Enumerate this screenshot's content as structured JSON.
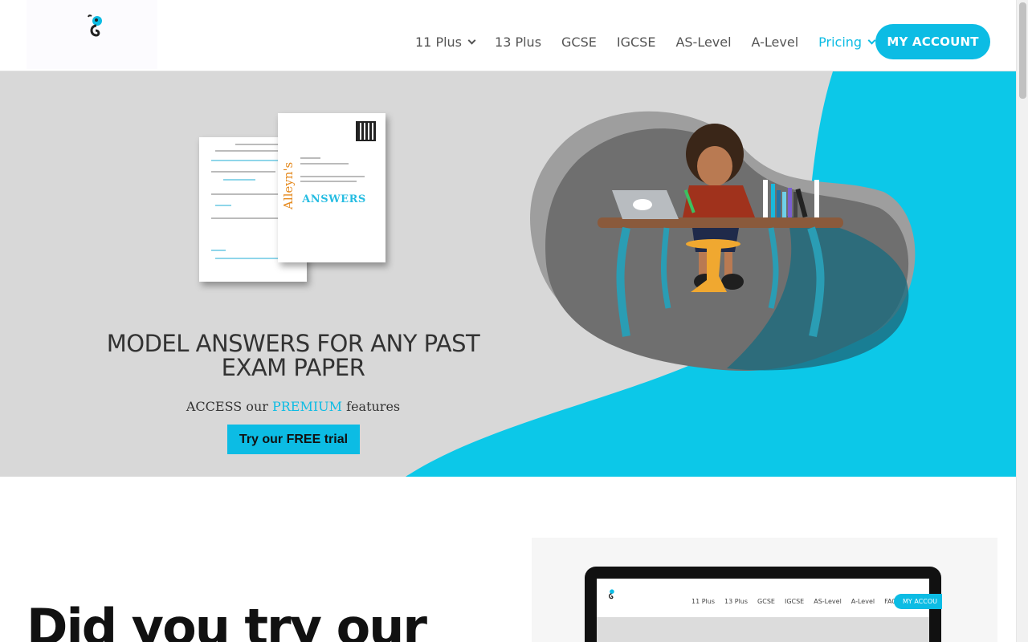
{
  "nav": {
    "items": [
      {
        "label": "11 Plus",
        "has_dropdown": true,
        "active": false
      },
      {
        "label": "13 Plus",
        "has_dropdown": false,
        "active": false
      },
      {
        "label": "GCSE",
        "has_dropdown": false,
        "active": false
      },
      {
        "label": "IGCSE",
        "has_dropdown": false,
        "active": false
      },
      {
        "label": "AS-Level",
        "has_dropdown": false,
        "active": false
      },
      {
        "label": "A-Level",
        "has_dropdown": false,
        "active": false
      },
      {
        "label": "Pricing",
        "has_dropdown": true,
        "active": true
      }
    ],
    "account_label": "MY ACCOUNT"
  },
  "hero": {
    "title_line1": "MODEL ANSWERS FOR ANY PAST",
    "title_line2": "EXAM PAPER",
    "sub_before": "ACCESS our",
    "sub_highlight": "PREMIUM",
    "sub_after": "features",
    "cta_label": "Try our FREE trial",
    "paper_brand": "Alleyn's",
    "paper_answers": "ANSWERS"
  },
  "section2": {
    "title": "Did you try our"
  },
  "preview": {
    "nav_items": [
      "11 Plus",
      "13 Plus",
      "GCSE",
      "IGCSE",
      "AS-Level",
      "A-Level",
      "FAQs"
    ],
    "button_label": "MY ACCOU"
  },
  "colors": {
    "accent": "#0cbce4",
    "hero_bg": "#d8d8d8",
    "text_dark": "#333333"
  }
}
